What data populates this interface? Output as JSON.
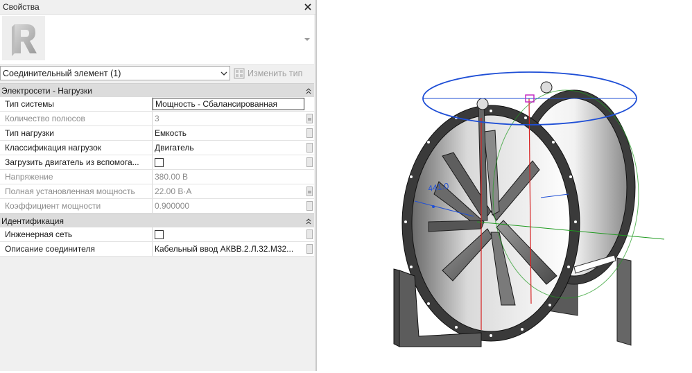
{
  "panel": {
    "title": "Свойства",
    "type_selector": "Соединительный элемент (1)",
    "edit_type": "Изменить тип"
  },
  "groups": [
    {
      "title": "Электросети - Нагрузки",
      "rows": [
        {
          "name": "Тип системы",
          "value": "Мощность - Сбалансированная"
        },
        {
          "name": "Количество полюсов",
          "value": "3"
        },
        {
          "name": "Тип нагрузки",
          "value": "Емкость"
        },
        {
          "name": "Классификация нагрузок",
          "value": "Двигатель"
        },
        {
          "name": "Загрузить двигатель из вспомога...",
          "value": ""
        },
        {
          "name": "Напряжение",
          "value": "380.00 В"
        },
        {
          "name": "Полная установленная мощность",
          "value": "22.00 В·А"
        },
        {
          "name": "Коэффициент мощности",
          "value": "0.900000"
        }
      ]
    },
    {
      "title": "Идентификация",
      "rows": [
        {
          "name": "Инженерная сеть",
          "value": ""
        },
        {
          "name": "Описание соединителя",
          "value": "Кабельный ввод АКВВ.2.Л.32.М32..."
        }
      ]
    }
  ],
  "viewport": {
    "dimension_label": "441.0",
    "colors": {
      "selection": "#1f4fd6",
      "axis_red": "#d62020",
      "axis_green": "#1f9a1f"
    }
  }
}
